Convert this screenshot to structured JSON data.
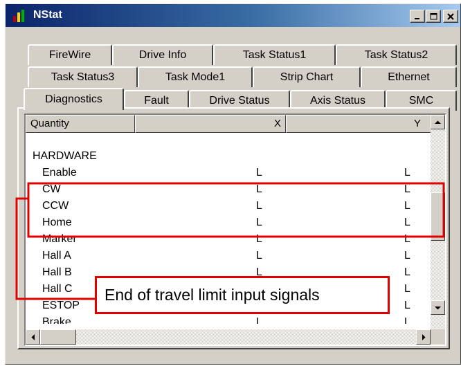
{
  "window": {
    "title": "NStat"
  },
  "tabs": {
    "row1": [
      "FireWire",
      "Drive Info",
      "Task Status1",
      "Task Status2"
    ],
    "row2": [
      "Task Status3",
      "Task Mode1",
      "Strip Chart",
      "Ethernet"
    ],
    "row3": [
      "Diagnostics",
      "Fault",
      "Drive Status",
      "Axis Status",
      "SMC"
    ],
    "active": "Diagnostics"
  },
  "table": {
    "columns": [
      "Quantity",
      "X",
      "Y"
    ],
    "rows": [
      {
        "quantity": "HARDWARE",
        "x": "",
        "y": ""
      },
      {
        "quantity": "Enable",
        "x": "L",
        "y": "L"
      },
      {
        "quantity": "CW",
        "x": "L",
        "y": "L"
      },
      {
        "quantity": "CCW",
        "x": "L",
        "y": "L"
      },
      {
        "quantity": "Home",
        "x": "L",
        "y": "L"
      },
      {
        "quantity": "Marker",
        "x": "L",
        "y": "L"
      },
      {
        "quantity": "Hall A",
        "x": "L",
        "y": "L"
      },
      {
        "quantity": "Hall B",
        "x": "L",
        "y": "L"
      },
      {
        "quantity": "Hall C",
        "x": "L",
        "y": "L"
      },
      {
        "quantity": "ESTOP",
        "x": "",
        "y": "L"
      },
      {
        "quantity": "Brake",
        "x": "L",
        "y": "L"
      }
    ]
  },
  "annotation": {
    "label": "End of travel limit input signals",
    "color": "#e00000"
  },
  "colors": {
    "titlebar_start": "#0a246a",
    "titlebar_end": "#a6caf0",
    "face": "#d4d0c8"
  },
  "icons": [
    "app-chart-icon",
    "minimize-icon",
    "maximize-icon",
    "close-icon",
    "scroll-up-arrow-icon",
    "scroll-down-arrow-icon",
    "scroll-left-arrow-icon",
    "scroll-right-arrow-icon"
  ]
}
